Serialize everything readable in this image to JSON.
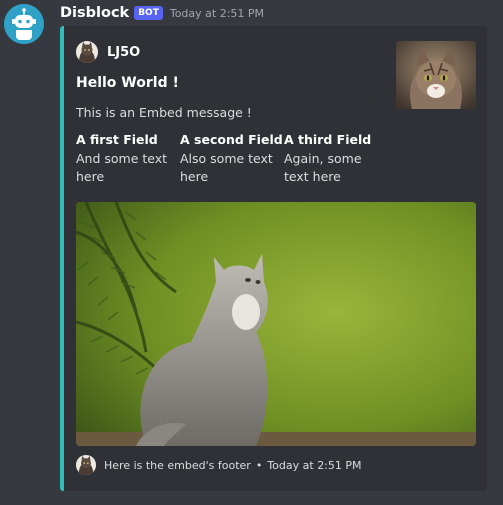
{
  "message": {
    "username": "Disblock",
    "bot_tag": "BOT",
    "timestamp": "Today at 2:51 PM",
    "avatar_icon": "robot-icon"
  },
  "embed": {
    "accent_color": "#2ebdb7",
    "author": {
      "name": "LJ5O",
      "icon": "cat-avatar"
    },
    "title": "Hello World !",
    "description": "This is an Embed message !",
    "fields": [
      {
        "name": "A first Field",
        "value": "And some text here"
      },
      {
        "name": "A second Field",
        "value": "Also some text here"
      },
      {
        "name": "A third Field",
        "value": "Again, some text here"
      }
    ],
    "thumbnail": "cat-face-photo",
    "image": "kitten-in-forest-photo",
    "footer": {
      "text": "Here is the embed's footer",
      "separator": "•",
      "timestamp": "Today at 2:51 PM",
      "icon": "cat-avatar"
    }
  }
}
